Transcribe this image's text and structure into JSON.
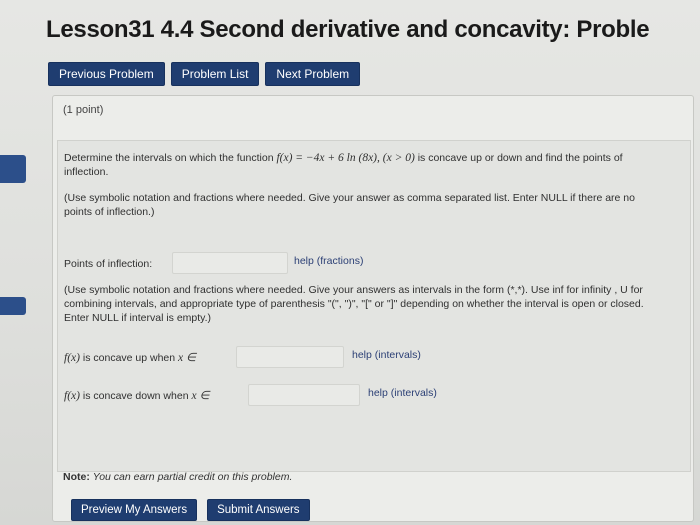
{
  "page": {
    "title": "Lesson31 4.4 Second derivative and concavity: Proble"
  },
  "nav": {
    "previous": "Previous Problem",
    "list": "Problem List",
    "next": "Next Problem"
  },
  "problem": {
    "points": "(1 point)",
    "prompt_intro": "Determine the intervals on which the function",
    "function": "f(x) = −4x + 6 ln (8x), (x > 0)",
    "prompt_end": "is concave up or down and find the points of",
    "prompt_line2": "inflection.",
    "instruction1_line1": "(Use symbolic notation and fractions where needed. Give your answer as comma separated list. Enter NULL if there are no",
    "instruction1_line2": "points of inflection.)",
    "inflection_label": "Points of inflection:",
    "inflection_value": "",
    "help_fractions": "help (fractions)",
    "instruction2_line1": "(Use symbolic notation and fractions where needed. Give your answers as intervals in the form (*,*). Use inf for infinity , U for",
    "instruction2_line2": "combining intervals, and appropriate type of parenthesis \"(\", \")\", \"[\" or \"]\" depending on whether the interval is open or closed.",
    "instruction2_line3": "Enter NULL if interval is empty.)",
    "concave_up_fx": "f(x)",
    "concave_up_label": "is concave up when",
    "concave_up_sym": "x ∈",
    "concave_up_value": "",
    "help_intervals_1": "help (intervals)",
    "concave_down_fx": "f(x)",
    "concave_down_label": "is concave down when",
    "concave_down_sym": "x ∈",
    "concave_down_value": "",
    "help_intervals_2": "help (intervals)"
  },
  "note": {
    "label": "Note:",
    "text": "You can earn partial credit on this problem."
  },
  "actions": {
    "preview": "Preview My Answers",
    "submit": "Submit Answers"
  }
}
